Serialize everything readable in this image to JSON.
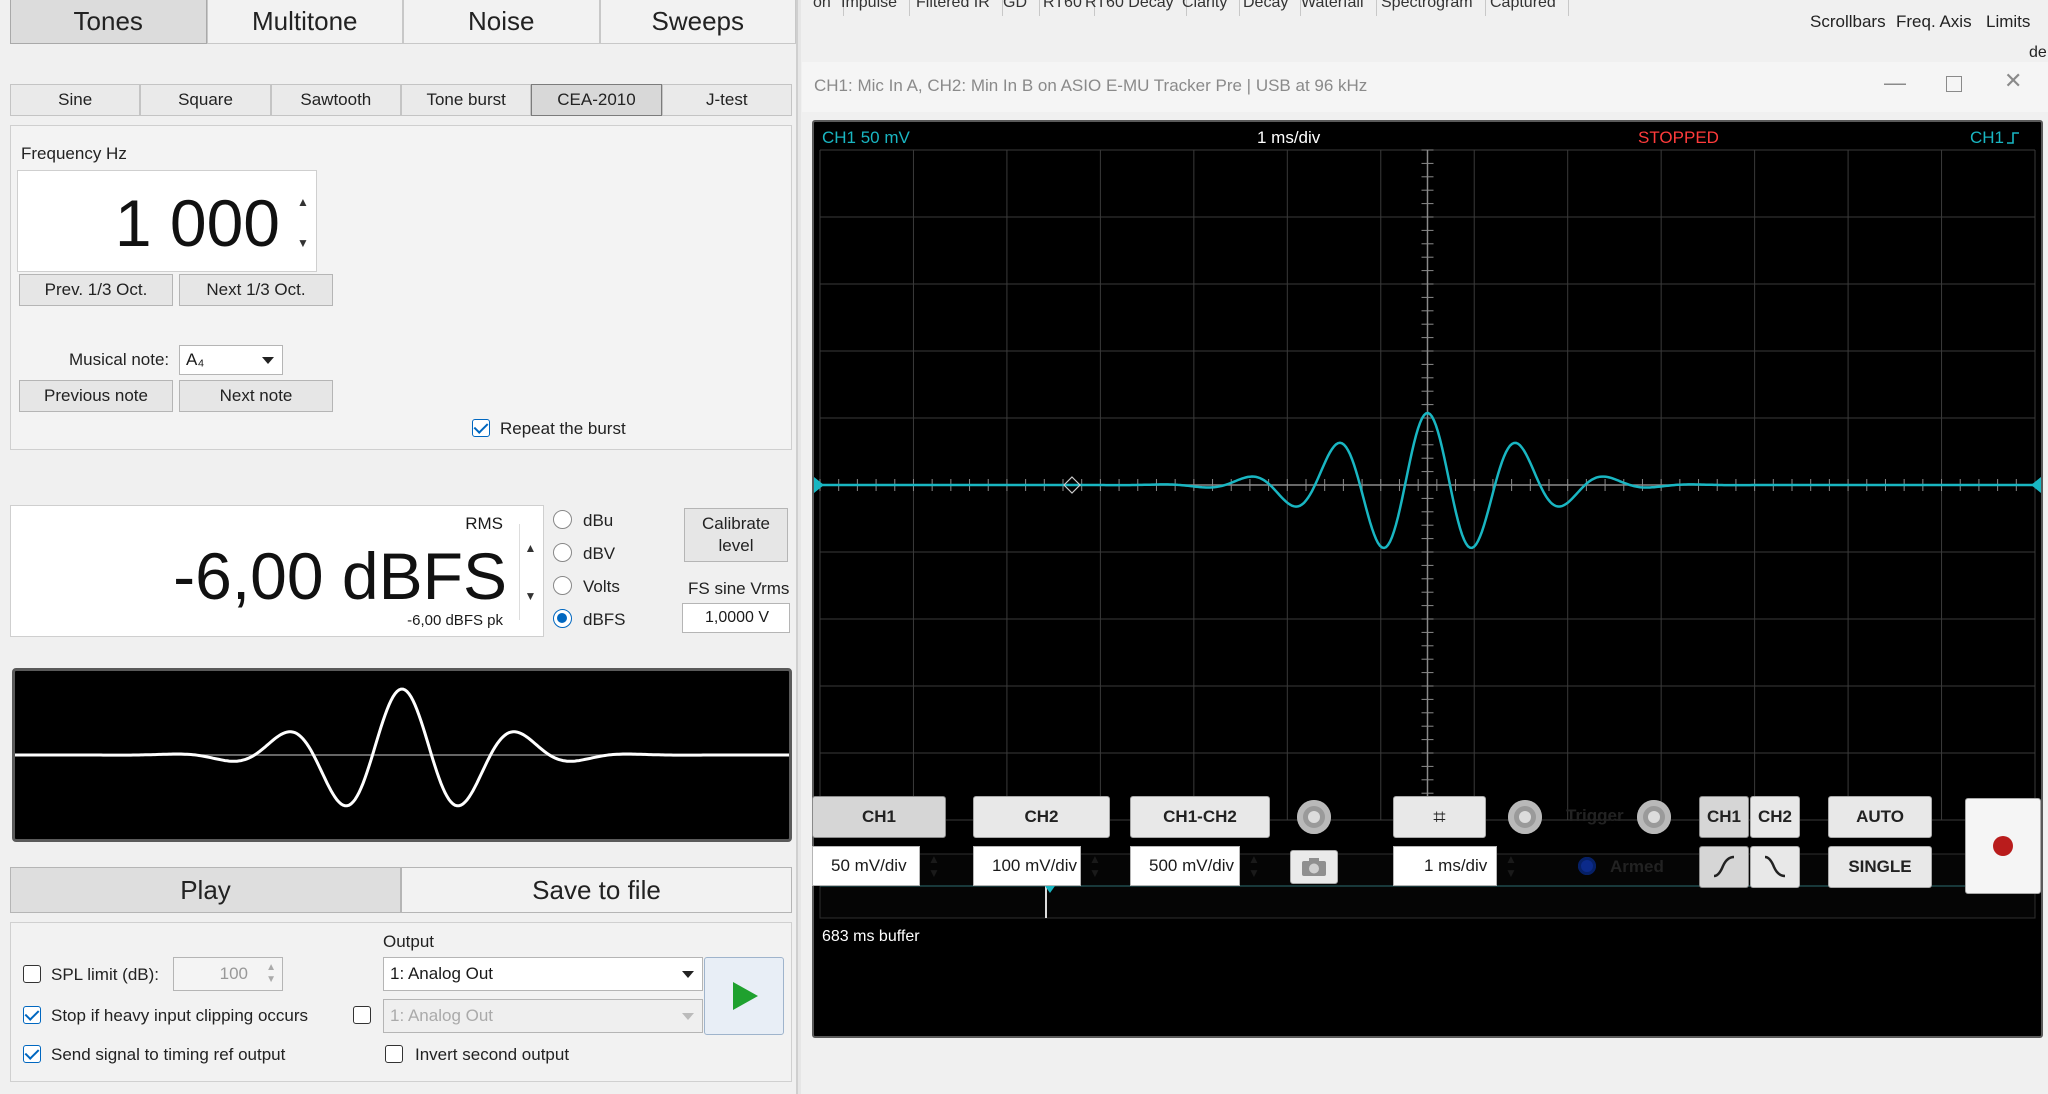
{
  "generator": {
    "main_tabs": [
      "Tones",
      "Multitone",
      "Noise",
      "Sweeps"
    ],
    "main_tab_active": 0,
    "sub_tabs": [
      "Sine",
      "Square",
      "Sawtooth",
      "Tone burst",
      "CEA-2010",
      "J-test"
    ],
    "sub_tab_active": 4,
    "frequency_label": "Frequency Hz",
    "frequency_value": "1 000",
    "prev_third_oct": "Prev. 1/3 Oct.",
    "next_third_oct": "Next 1/3 Oct.",
    "musical_note_label": "Musical note:",
    "musical_note_value": "A₄",
    "previous_note": "Previous note",
    "next_note": "Next note",
    "repeat_burst_label": "Repeat the burst",
    "repeat_burst_checked": true,
    "level_type": "RMS",
    "level_value": "-6,00 dBFS",
    "level_peak": "-6,00 dBFS pk",
    "unit_options": [
      "dBu",
      "dBV",
      "Volts",
      "dBFS"
    ],
    "unit_selected": "dBFS",
    "calibrate_label": "Calibrate level",
    "fs_sine_label": "FS sine Vrms",
    "fs_sine_value": "1,0000 V",
    "play_tab": "Play",
    "save_tab": "Save to file",
    "output_label": "Output",
    "spl_limit_label": "SPL limit (dB):",
    "spl_limit_value": "100",
    "stop_clipping_label": "Stop if heavy input clipping occurs",
    "send_timing_label": "Send signal to timing ref output",
    "invert_second_label": "Invert second output",
    "output_primary": "1: Analog Out",
    "output_secondary": "1: Analog Out"
  },
  "top_strip": {
    "tabs": [
      "on",
      "Impulse",
      "Filtered IR",
      "GD",
      "RT60",
      "RT60 Decay",
      "Clarity",
      "Decay",
      "Waterfall",
      "Spectrogram",
      "Captured"
    ],
    "right_labels": [
      "Scrollbars",
      "Freq. Axis",
      "Limits"
    ],
    "edge_text": "de"
  },
  "scope": {
    "window_title": "CH1: Mic In A, CH2: Min In B on ASIO E-MU Tracker Pre | USB at 96 kHz",
    "ch1_scale": "CH1 50 mV",
    "timebase": "1 ms/div",
    "status": "STOPPED",
    "trigger_channel": "CH1",
    "buffer_label": "683 ms buffer",
    "trace_color": "#19b6c2",
    "status_color": "#ff3b3b",
    "buttons": {
      "ch1": "CH1",
      "ch2": "CH2",
      "ch1_ch2": "CH1-CH2",
      "trigger": "Trigger",
      "trig_ch1": "CH1",
      "trig_ch2": "CH2",
      "auto": "AUTO",
      "single": "SINGLE",
      "armed": "Armed"
    },
    "ch1_div": "50 mV/div",
    "ch2_div": "100 mV/div",
    "diff_div": "500 mV/div",
    "time_div": "1 ms/div"
  }
}
